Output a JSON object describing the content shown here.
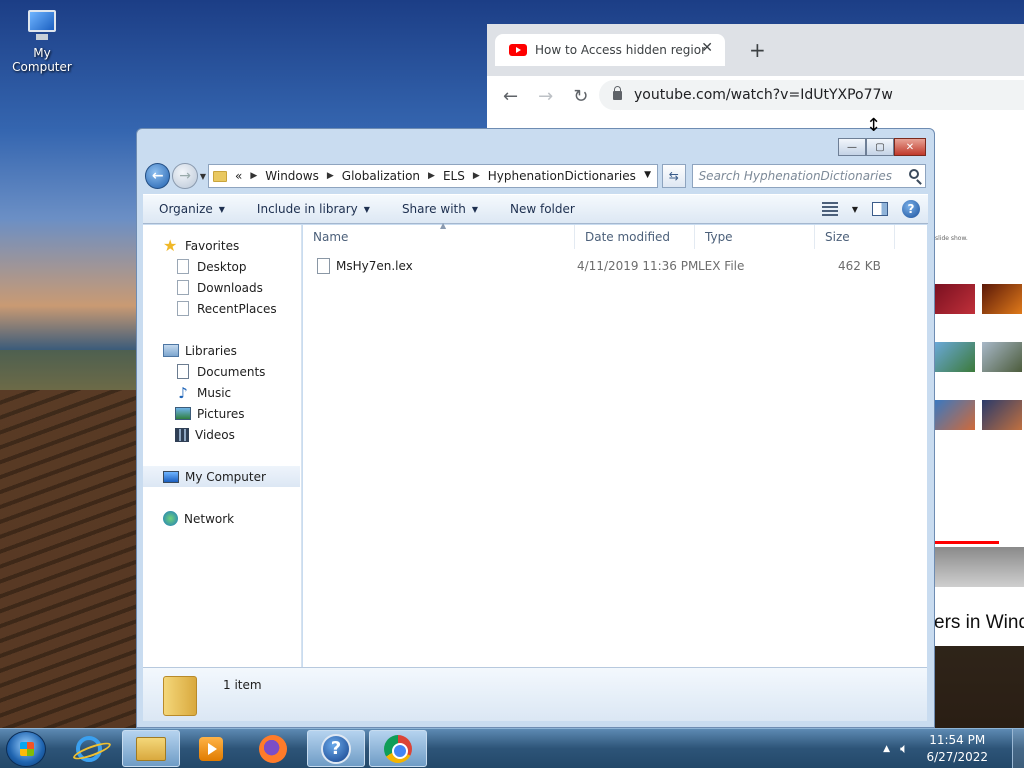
{
  "desktop": {
    "icon_label": "My Computer"
  },
  "browser": {
    "tab_title": "How to Access hidden regional t",
    "tab_close": "✕",
    "new_tab": "+",
    "url": "youtube.com/watch?v=IdUtYXPo77w",
    "page_note": "slide show.",
    "video_title_fragment": "ers in Windo"
  },
  "explorer": {
    "window_buttons": {
      "minimize": "—",
      "maximize": "▢",
      "close": "✕"
    },
    "breadcrumb": {
      "overflow": "«",
      "segments": [
        "Windows",
        "Globalization",
        "ELS",
        "HyphenationDictionaries"
      ]
    },
    "search_placeholder": "Search HyphenationDictionaries",
    "toolbar": {
      "organize": "Organize",
      "include_in_library": "Include in library",
      "share_with": "Share with",
      "new_folder": "New folder"
    },
    "nav": {
      "favorites": "Favorites",
      "desktop": "Desktop",
      "downloads": "Downloads",
      "recent_places": "RecentPlaces",
      "libraries": "Libraries",
      "documents": "Documents",
      "music": "Music",
      "pictures": "Pictures",
      "videos": "Videos",
      "my_computer": "My Computer",
      "network": "Network"
    },
    "columns": {
      "name": "Name",
      "date_modified": "Date modified",
      "type": "Type",
      "size": "Size"
    },
    "files": [
      {
        "name": "MsHy7en.lex",
        "date_modified": "4/11/2019 11:36 PM",
        "type": "LEX File",
        "size": "462 KB"
      }
    ],
    "status": {
      "item_count": "1 item"
    }
  },
  "taskbar": {
    "time": "11:54 PM",
    "date": "6/27/2022"
  },
  "colors": {
    "explorer_frame": "#c9dcf0",
    "youtube_red": "#ff0000",
    "taskbar": "#2d5478"
  }
}
